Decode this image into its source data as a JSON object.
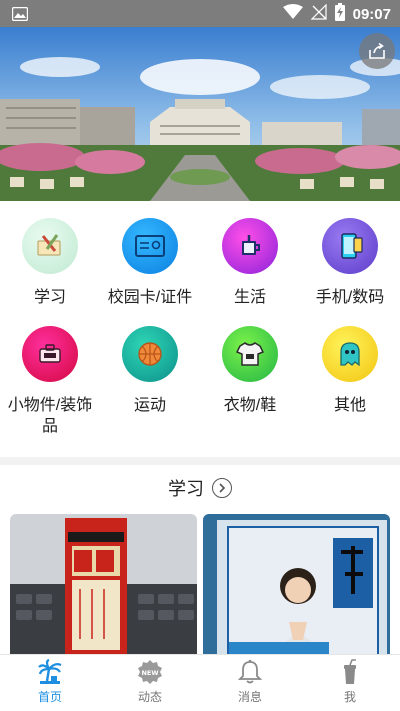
{
  "status_bar": {
    "time": "09:07"
  },
  "categories": [
    {
      "label": "学习",
      "icon": "study-icon"
    },
    {
      "label": "校园卡/证件",
      "icon": "campus-card-icon"
    },
    {
      "label": "生活",
      "icon": "life-icon"
    },
    {
      "label": "手机/数码",
      "icon": "phone-icon"
    },
    {
      "label": "小物件/装饰品",
      "icon": "trinket-icon"
    },
    {
      "label": "运动",
      "icon": "ball-icon"
    },
    {
      "label": "衣物/鞋",
      "icon": "clothes-icon"
    },
    {
      "label": "其他",
      "icon": "other-icon"
    }
  ],
  "section": {
    "title": "学习"
  },
  "tabs": [
    {
      "label": "首页",
      "icon": "home-icon",
      "active": true
    },
    {
      "label": "动态",
      "icon": "new-badge-icon",
      "active": false
    },
    {
      "label": "消息",
      "icon": "bell-icon",
      "active": false
    },
    {
      "label": "我",
      "icon": "cup-icon",
      "active": false
    }
  ],
  "colors": {
    "accent": "#1e8fe0",
    "status_bar": "#7d7d7d"
  }
}
